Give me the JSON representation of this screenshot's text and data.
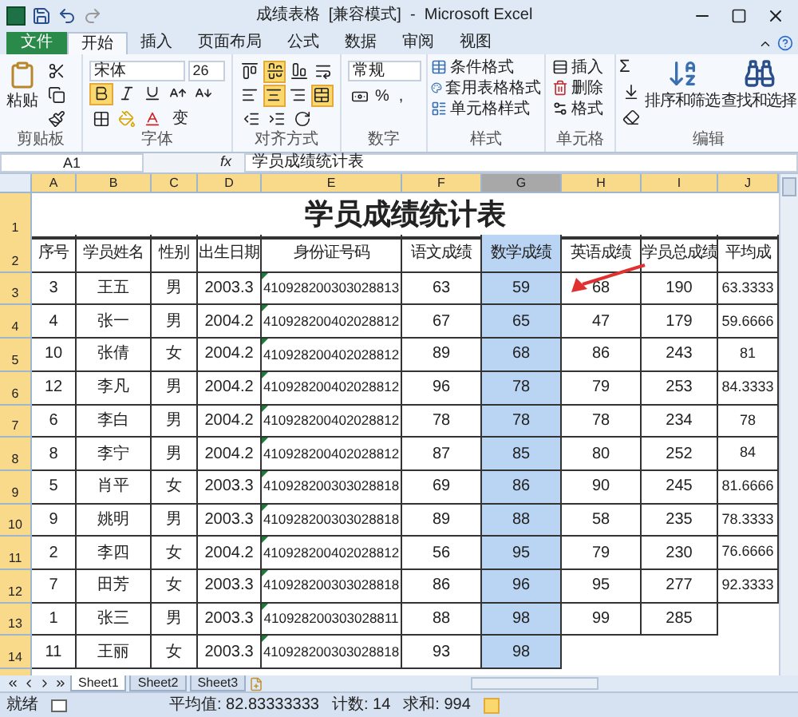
{
  "window": {
    "title": "成绩表格  [兼容模式]  -  Microsoft Excel"
  },
  "tabs": [
    {
      "label": "文件",
      "kind": "file",
      "selected": false
    },
    {
      "label": "开始",
      "kind": "tab",
      "selected": true
    },
    {
      "label": "插入",
      "kind": "tab",
      "selected": false
    },
    {
      "label": "页面布局",
      "kind": "tab",
      "selected": false
    },
    {
      "label": "公式",
      "kind": "tab",
      "selected": false
    },
    {
      "label": "数据",
      "kind": "tab",
      "selected": false
    },
    {
      "label": "审阅",
      "kind": "tab",
      "selected": false
    },
    {
      "label": "视图",
      "kind": "tab",
      "selected": false
    }
  ],
  "ribbon": {
    "clipboard": {
      "paste": "粘贴",
      "label": "剪贴板"
    },
    "font": {
      "name": "宋体",
      "size": "26",
      "bold": true,
      "italic": false,
      "underline": false,
      "phonetic": "变",
      "label": "字体"
    },
    "alignment": {
      "middle": true,
      "center": true,
      "merge": true,
      "label": "对齐方式"
    },
    "number": {
      "format": "常规",
      "percent": "%",
      "comma": ",",
      "label": "数字"
    },
    "styles": {
      "items": [
        "条件格式",
        "套用表格格式",
        "单元格样式"
      ],
      "label": "样式"
    },
    "cells": {
      "items": [
        "插入",
        "删除",
        "格式"
      ],
      "label": "单元格"
    },
    "editing": {
      "sum": "Σ",
      "sort": "排序和筛选",
      "find": "查找和选择",
      "label": "编辑"
    }
  },
  "formula_bar": {
    "name_box": "A1",
    "fx": "fx",
    "value": "学员成绩统计表"
  },
  "sheet": {
    "columns": [
      {
        "letter": "A",
        "selected": false
      },
      {
        "letter": "B",
        "selected": false
      },
      {
        "letter": "C",
        "selected": false
      },
      {
        "letter": "D",
        "selected": false
      },
      {
        "letter": "E",
        "selected": false,
        "text_numbers": true
      },
      {
        "letter": "F",
        "selected": false
      },
      {
        "letter": "G",
        "selected": true
      },
      {
        "letter": "H",
        "selected": false
      },
      {
        "letter": "I",
        "selected": false
      },
      {
        "letter": "J",
        "selected": false
      }
    ],
    "title": "学员成绩统计表",
    "row_numbers": [
      "1",
      "2",
      "3",
      "4",
      "5",
      "6",
      "7",
      "8",
      "9",
      "10",
      "11",
      "12",
      "13",
      "14"
    ],
    "header": [
      "序号",
      "学员姓名",
      "性别",
      "出生日期",
      "身份证号码",
      "语文成绩",
      "数学成绩",
      "英语成绩",
      "学员总成绩",
      "平均成"
    ],
    "rows": [
      [
        "3",
        "王五",
        "男",
        "2003.3",
        "410928200303028813",
        "63",
        "59",
        "68",
        "190",
        "63.3333"
      ],
      [
        "4",
        "张一",
        "男",
        "2004.2",
        "410928200402028812",
        "67",
        "65",
        "47",
        "179",
        "59.6666"
      ],
      [
        "10",
        "张倩",
        "女",
        "2004.2",
        "410928200402028812",
        "89",
        "68",
        "86",
        "243",
        "81"
      ],
      [
        "12",
        "李凡",
        "男",
        "2004.2",
        "410928200402028812",
        "96",
        "78",
        "79",
        "253",
        "84.3333"
      ],
      [
        "6",
        "李白",
        "男",
        "2004.2",
        "410928200402028812",
        "78",
        "78",
        "78",
        "234",
        "78"
      ],
      [
        "8",
        "李宁",
        "男",
        "2004.2",
        "410928200402028812",
        "87",
        "85",
        "80",
        "252",
        "84"
      ],
      [
        "5",
        "肖平",
        "女",
        "2003.3",
        "410928200303028818",
        "69",
        "86",
        "90",
        "245",
        "81.6666"
      ],
      [
        "9",
        "姚明",
        "男",
        "2003.3",
        "410928200303028818",
        "89",
        "88",
        "58",
        "235",
        "78.3333"
      ],
      [
        "2",
        "李四",
        "女",
        "2004.2",
        "410928200402028812",
        "56",
        "95",
        "79",
        "230",
        "76.6666"
      ],
      [
        "7",
        "田芳",
        "女",
        "2003.3",
        "410928200303028818",
        "86",
        "96",
        "95",
        "277",
        "92.3333"
      ],
      [
        "1",
        "张三",
        "男",
        "2003.3",
        "410928200303028811",
        "88",
        "98",
        "99",
        "285"
      ],
      [
        "11",
        "王丽",
        "女",
        "2003.3",
        "410928200303028818",
        "93",
        "98"
      ]
    ]
  },
  "sheet_tabs": [
    {
      "label": "Sheet1",
      "selected": true
    },
    {
      "label": "Sheet2",
      "selected": false
    },
    {
      "label": "Sheet3",
      "selected": false
    }
  ],
  "status_bar": {
    "mode": "就绪",
    "average": "平均值: 82.83333333",
    "count": "计数: 14",
    "sum": "求和: 994"
  }
}
